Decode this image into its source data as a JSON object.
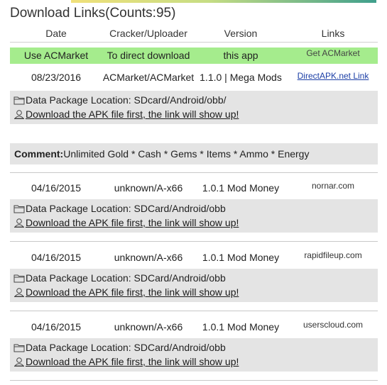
{
  "heading": "Download Links(Counts:95)",
  "columns": [
    "Date",
    "Cracker/Uploader",
    "Version",
    "Links"
  ],
  "promo": {
    "col1": "Use ACMarket",
    "col2": "To direct download",
    "col3": "this app",
    "link": "Get ACMarket"
  },
  "entries": [
    {
      "date": "08/23/2016",
      "uploader": "ACMarket/ACMarket",
      "version": "1.1.0 | Mega Mods",
      "link": "DirectAPK.net Link",
      "data_location": "Data Package Location: SDcard/Android/obb/",
      "download_text": "Download the APK file first, the link will show up!"
    },
    {
      "date": "04/16/2015",
      "uploader": "unknown/A-x66",
      "version": "1.0.1 Mod Money",
      "link": "nornar.com",
      "data_location": "Data Package Location: SDCard/Android/obb",
      "download_text": "Download the APK file first, the link will show up!"
    },
    {
      "date": "04/16/2015",
      "uploader": "unknown/A-x66",
      "version": "1.0.1 Mod Money",
      "link": "rapidfileup.com",
      "data_location": "Data Package Location: SDCard/Android/obb",
      "download_text": "Download the APK file first, the link will show up!"
    },
    {
      "date": "04/16/2015",
      "uploader": "unknown/A-x66",
      "version": "1.0.1 Mod Money",
      "link": "userscloud.com",
      "data_location": "Data Package Location: SDCard/Android/obb",
      "download_text": "Download the APK file first, the link will show up!"
    }
  ],
  "comment": {
    "label": "Comment:",
    "text": "Unlimited Gold * Cash * Gems * Items * Ammo * Energy"
  },
  "colors": {
    "promo_bg": "#a5ec8d",
    "box_bg": "#e4e4e4",
    "link_blue": "#1c3fa6"
  },
  "icons": [
    "folder-icon",
    "download-user-icon"
  ]
}
